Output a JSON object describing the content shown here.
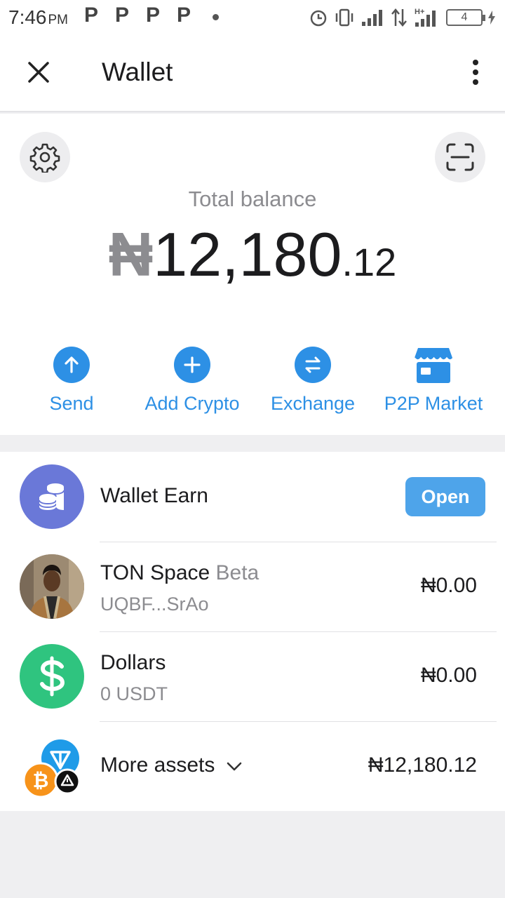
{
  "status_bar": {
    "time": "7:46",
    "ampm": "PM",
    "notif_letter": "P",
    "battery": "4"
  },
  "app_bar": {
    "title": "Wallet",
    "close_icon": "close-icon",
    "menu_icon": "more-vertical-icon"
  },
  "balance": {
    "label": "Total balance",
    "currency_symbol": "₦",
    "integer_part": "12,180",
    "decimal_part": ".12"
  },
  "actions": [
    {
      "label": "Send",
      "icon": "arrow-up-icon"
    },
    {
      "label": "Add Crypto",
      "icon": "plus-icon"
    },
    {
      "label": "Exchange",
      "icon": "exchange-icon"
    },
    {
      "label": "P2P Market",
      "icon": "store-icon"
    }
  ],
  "list": {
    "earn": {
      "title": "Wallet Earn",
      "button": "Open"
    },
    "ton_space": {
      "title": "TON Space",
      "badge": "Beta",
      "address": "UQBF...SrAo",
      "amount": "₦0.00"
    },
    "dollars": {
      "title": "Dollars",
      "sub": "0 USDT",
      "amount": "₦0.00"
    },
    "more": {
      "title": "More assets",
      "amount": "₦12,180.12"
    }
  },
  "colors": {
    "accent": "#2d90e5",
    "open_button": "#4ea4ea",
    "earn_icon_bg": "#6a78d8",
    "usdt_green": "#2fc47f",
    "btc_orange": "#f7931a",
    "ton_blue": "#1f9be8"
  }
}
